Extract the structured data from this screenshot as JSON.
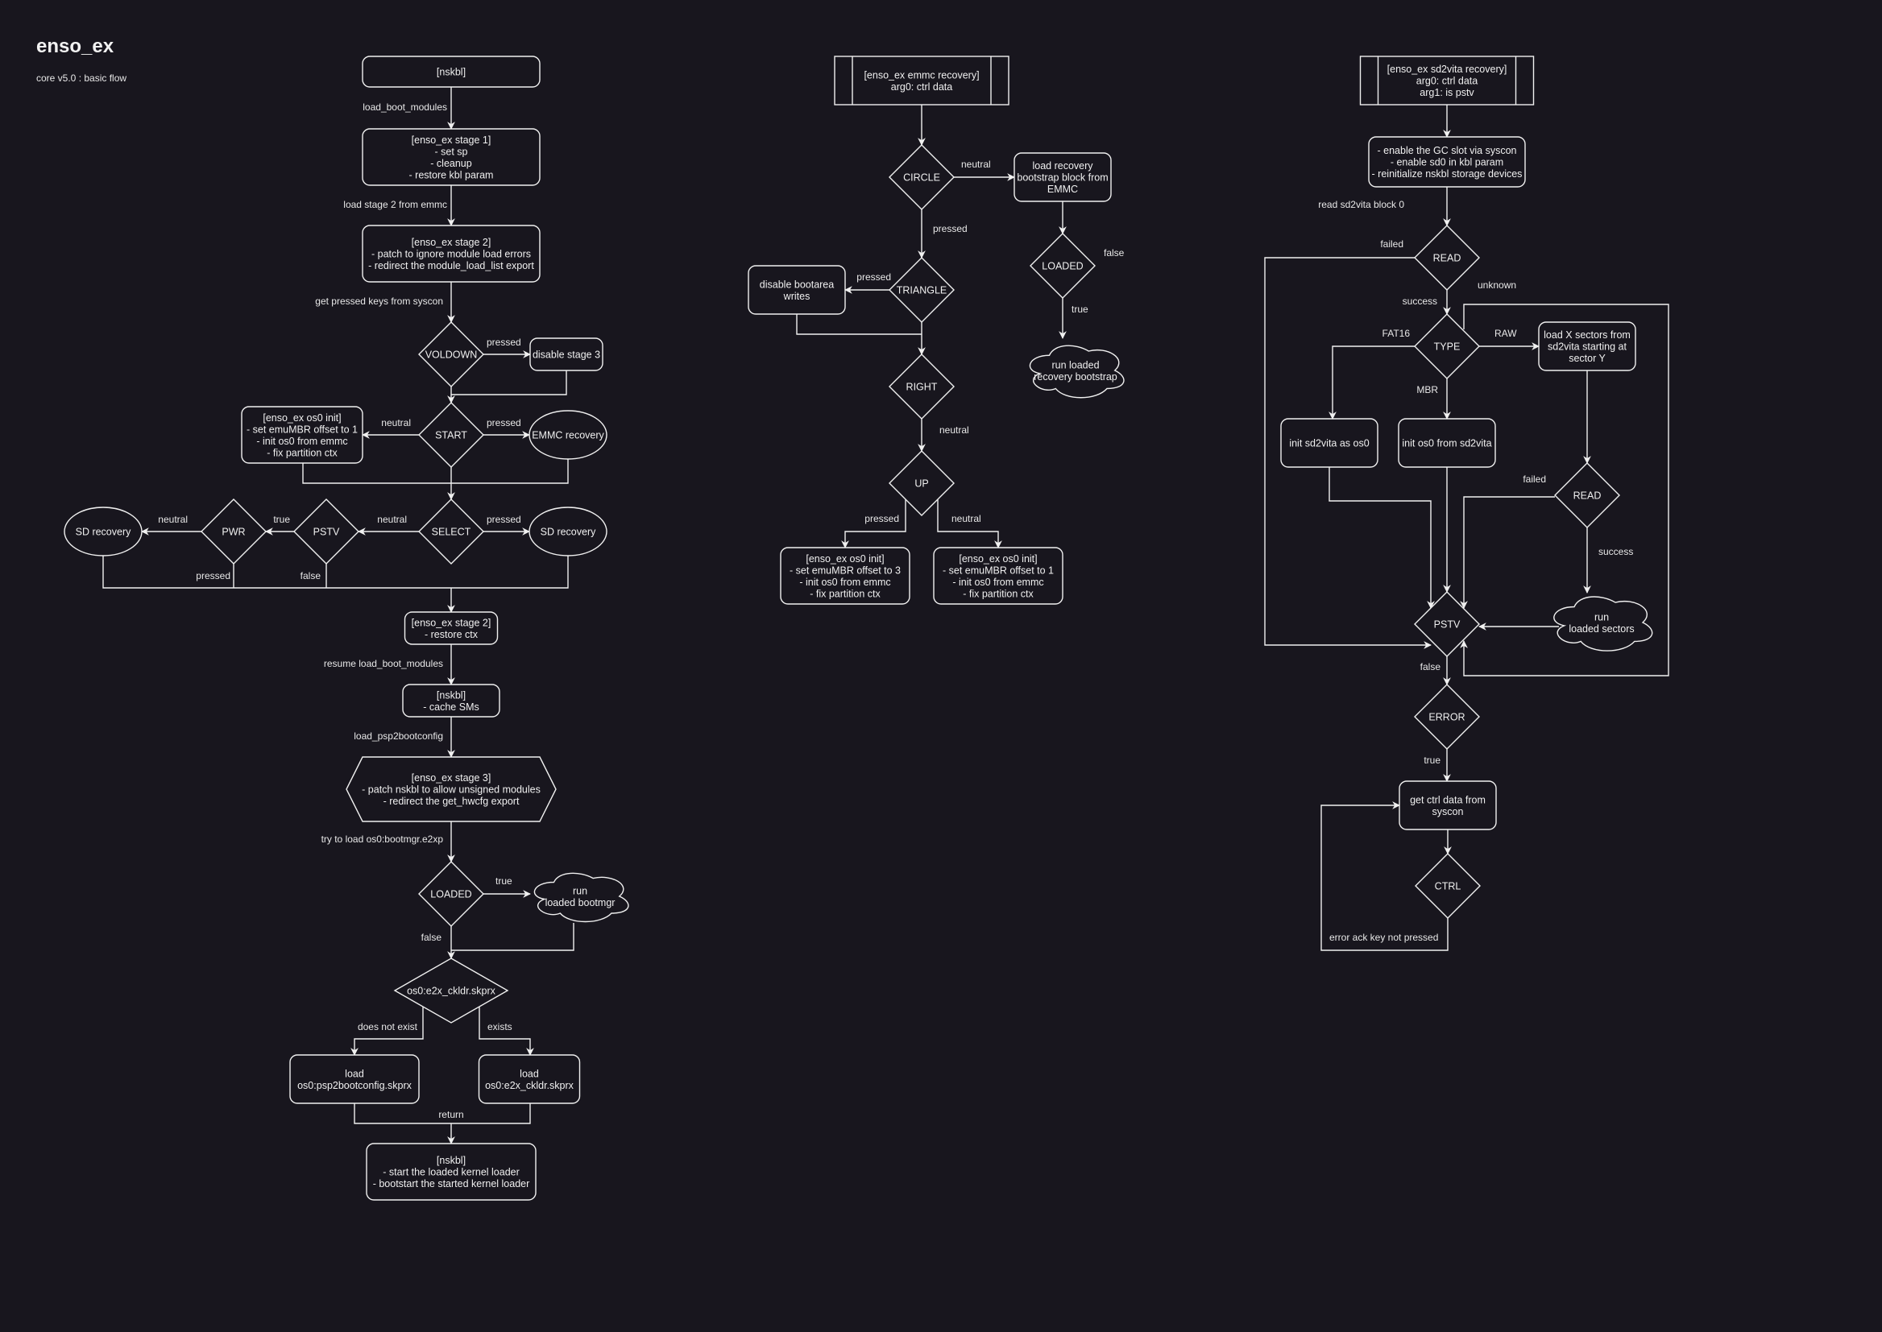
{
  "header": {
    "title": "enso_ex",
    "subtitle": "core v5.0 : basic flow"
  },
  "colors": {
    "background": "#18161e",
    "stroke": "#f0f0f0",
    "text": "#f0f0f0"
  },
  "flows": [
    {
      "name": "main-boot-flow",
      "nodes": [
        {
          "id": "nskbl-start",
          "shape": "rounded-rect",
          "lines": [
            "[nskbl]"
          ]
        },
        {
          "id": "stage1",
          "shape": "rounded-rect",
          "lines": [
            "[enso_ex stage 1]",
            "- set sp",
            "- cleanup",
            "- restore kbl param"
          ]
        },
        {
          "id": "stage2",
          "shape": "rounded-rect",
          "lines": [
            "[enso_ex stage 2]",
            "- patch to ignore module load errors",
            "- redirect the module_load_list export"
          ]
        },
        {
          "id": "voldown",
          "shape": "diamond",
          "lines": [
            "VOLDOWN"
          ]
        },
        {
          "id": "disable-stage3",
          "shape": "rounded-rect",
          "lines": [
            "disable stage 3"
          ]
        },
        {
          "id": "start",
          "shape": "diamond",
          "lines": [
            "START"
          ]
        },
        {
          "id": "os0-init-main",
          "shape": "rounded-rect",
          "lines": [
            "[enso_ex os0 init]",
            "- set emuMBR offset to 1",
            "- init os0 from emmc",
            "- fix partition ctx"
          ]
        },
        {
          "id": "emmc-recovery",
          "shape": "ellipse",
          "lines": [
            "EMMC recovery"
          ]
        },
        {
          "id": "select",
          "shape": "diamond",
          "lines": [
            "SELECT"
          ]
        },
        {
          "id": "sd-recovery-right",
          "shape": "ellipse",
          "lines": [
            "SD recovery"
          ]
        },
        {
          "id": "pstv",
          "shape": "diamond",
          "lines": [
            "PSTV"
          ]
        },
        {
          "id": "pwr",
          "shape": "diamond",
          "lines": [
            "PWR"
          ]
        },
        {
          "id": "sd-recovery-left",
          "shape": "ellipse",
          "lines": [
            "SD recovery"
          ]
        },
        {
          "id": "stage2-restore",
          "shape": "rounded-rect",
          "lines": [
            "[enso_ex stage 2]",
            "- restore ctx"
          ]
        },
        {
          "id": "nskbl-cache",
          "shape": "rounded-rect",
          "lines": [
            "[nskbl]",
            "- cache SMs"
          ]
        },
        {
          "id": "stage3",
          "shape": "hexagon",
          "lines": [
            "[enso_ex stage 3]",
            "- patch nskbl to allow unsigned modules",
            "- redirect the get_hwcfg export"
          ]
        },
        {
          "id": "loaded-main",
          "shape": "diamond",
          "lines": [
            "LOADED"
          ]
        },
        {
          "id": "run-bootmgr",
          "shape": "cloud",
          "lines": [
            "run",
            "loaded bootmgr"
          ]
        },
        {
          "id": "e2x-check",
          "shape": "diamond",
          "lines": [
            "os0:e2x_ckldr.skprx"
          ]
        },
        {
          "id": "load-psp2",
          "shape": "rounded-rect",
          "lines": [
            "load",
            "os0:psp2bootconfig.skprx"
          ]
        },
        {
          "id": "load-e2x",
          "shape": "rounded-rect",
          "lines": [
            "load",
            "os0:e2x_ckldr.skprx"
          ]
        },
        {
          "id": "nskbl-final",
          "shape": "rounded-rect",
          "lines": [
            "[nskbl]",
            "- start the loaded kernel loader",
            "- bootstart the started kernel loader"
          ]
        }
      ],
      "edge_labels": {
        "load_boot_modules": "load_boot_modules",
        "load_stage2": "load stage 2 from emmc",
        "get_keys": "get pressed keys from syscon",
        "voldown_pressed": "pressed",
        "start_neutral": "neutral",
        "start_pressed": "pressed",
        "select_neutral": "neutral",
        "select_pressed": "pressed",
        "pstv_true": "true",
        "pstv_false": "false",
        "pwr_neutral": "neutral",
        "pwr_pressed": "pressed",
        "resume": "resume load_boot_modules",
        "load_psp2bootconfig": "load_psp2bootconfig",
        "try_load": "try to load os0:bootmgr.e2xp",
        "loaded_true": "true",
        "loaded_false": "false",
        "not_exist": "does not exist",
        "exists": "exists",
        "return": "return"
      }
    },
    {
      "name": "emmc-recovery-flow",
      "nodes": [
        {
          "id": "emmc-header",
          "shape": "process",
          "lines": [
            "[enso_ex emmc recovery]",
            "arg0: ctrl data"
          ]
        },
        {
          "id": "circle",
          "shape": "diamond",
          "lines": [
            "CIRCLE"
          ]
        },
        {
          "id": "load-recovery",
          "shape": "rounded-rect",
          "lines": [
            "load recovery",
            "bootstrap block from",
            "EMMC"
          ]
        },
        {
          "id": "loaded-emmc",
          "shape": "diamond",
          "lines": [
            "LOADED"
          ]
        },
        {
          "id": "run-recovery",
          "shape": "cloud",
          "lines": [
            "run loaded",
            "recovery bootstrap"
          ]
        },
        {
          "id": "triangle",
          "shape": "diamond",
          "lines": [
            "TRIANGLE"
          ]
        },
        {
          "id": "disable-bootarea",
          "shape": "rounded-rect",
          "lines": [
            "disable bootarea",
            "writes"
          ]
        },
        {
          "id": "right",
          "shape": "diamond",
          "lines": [
            "RIGHT"
          ]
        },
        {
          "id": "up",
          "shape": "diamond",
          "lines": [
            "UP"
          ]
        },
        {
          "id": "os0-init-3",
          "shape": "rounded-rect",
          "lines": [
            "[enso_ex os0 init]",
            "- set emuMBR offset to 3",
            "- init os0 from emmc",
            "- fix partition ctx"
          ]
        },
        {
          "id": "os0-init-1",
          "shape": "rounded-rect",
          "lines": [
            "[enso_ex os0 init]",
            "- set emuMBR offset to 1",
            "- init os0 from emmc",
            "- fix partition ctx"
          ]
        }
      ],
      "edge_labels": {
        "circle_neutral": "neutral",
        "circle_pressed": "pressed",
        "loaded_false": "false",
        "loaded_true": "true",
        "triangle_pressed": "pressed",
        "right_neutral": "neutral",
        "up_pressed": "pressed",
        "up_neutral": "neutral"
      }
    },
    {
      "name": "sd2vita-recovery-flow",
      "nodes": [
        {
          "id": "sd2vita-header",
          "shape": "process",
          "lines": [
            "[enso_ex sd2vita recovery]",
            "arg0: ctrl data",
            "arg1: is pstv"
          ]
        },
        {
          "id": "enable-gc",
          "shape": "rounded-rect",
          "lines": [
            "- enable the GC slot via syscon",
            "- enable sd0 in kbl param",
            "- reinitialize nskbl storage devices"
          ]
        },
        {
          "id": "read1",
          "shape": "diamond",
          "lines": [
            "READ"
          ]
        },
        {
          "id": "type",
          "shape": "diamond",
          "lines": [
            "TYPE"
          ]
        },
        {
          "id": "load-sectors",
          "shape": "rounded-rect",
          "lines": [
            "load X sectors from",
            "sd2vita starting at",
            "sector Y"
          ]
        },
        {
          "id": "init-sd2vita-os0",
          "shape": "rounded-rect",
          "lines": [
            "init sd2vita as os0"
          ]
        },
        {
          "id": "init-os0-sd2vita",
          "shape": "rounded-rect",
          "lines": [
            "init os0 from sd2vita"
          ]
        },
        {
          "id": "read2",
          "shape": "diamond",
          "lines": [
            "READ"
          ]
        },
        {
          "id": "run-sectors",
          "shape": "cloud",
          "lines": [
            "run",
            "loaded sectors"
          ]
        },
        {
          "id": "pstv-sd",
          "shape": "diamond",
          "lines": [
            "PSTV"
          ]
        },
        {
          "id": "error",
          "shape": "diamond",
          "lines": [
            "ERROR"
          ]
        },
        {
          "id": "get-ctrl",
          "shape": "rounded-rect",
          "lines": [
            "get ctrl data from",
            "syscon"
          ]
        },
        {
          "id": "ctrl",
          "shape": "diamond",
          "lines": [
            "CTRL"
          ]
        }
      ],
      "edge_labels": {
        "read_block0": "read sd2vita block 0",
        "read1_failed": "failed",
        "read1_success": "success",
        "type_unknown": "unknown",
        "type_fat16": "FAT16",
        "type_raw": "RAW",
        "type_mbr": "MBR",
        "read2_failed": "failed",
        "read2_success": "success",
        "pstv_false": "false",
        "error_true": "true",
        "ctrl_loop": "error ack key not pressed"
      }
    }
  ]
}
